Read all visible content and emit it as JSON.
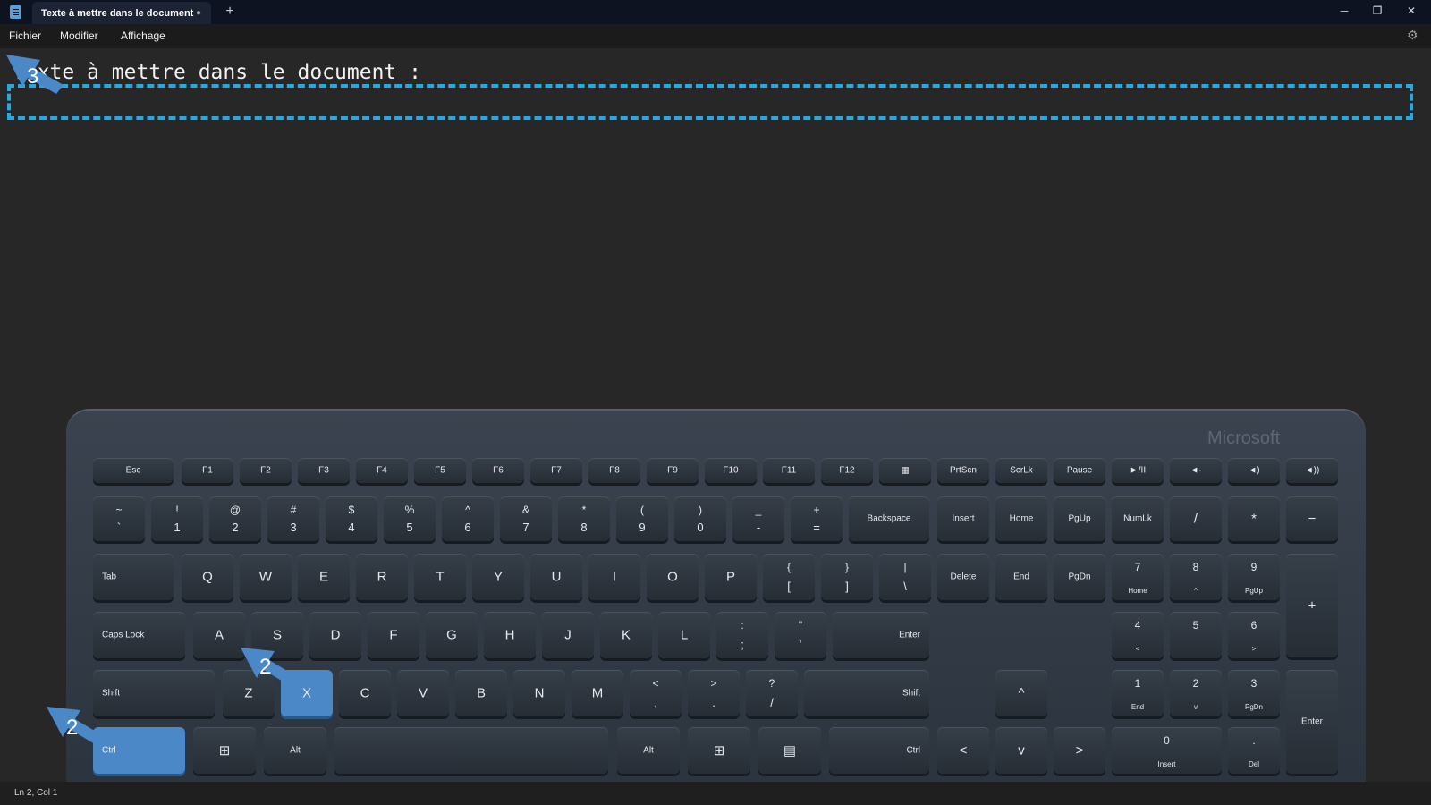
{
  "window": {
    "tab_title": "Texte à mettre dans le document",
    "unsaved_dot": "●",
    "new_tab": "+",
    "minimize": "─",
    "maximize": "❐",
    "close": "✕"
  },
  "menu": {
    "items": [
      "Fichier",
      "Modifier",
      "Affichage"
    ],
    "settings_icon": "gear-icon"
  },
  "editor": {
    "line1": "Texte à mettre dans le document :",
    "highlight_color": "#29a8e0"
  },
  "callouts": {
    "step3": "3",
    "step2_x": "2",
    "step2_ctrl": "2",
    "arrow_color": "#4a88c7"
  },
  "keyboard": {
    "brand": "Microsoft",
    "row_fn": [
      "Esc",
      "F1",
      "F2",
      "F3",
      "F4",
      "F5",
      "F6",
      "F7",
      "F8",
      "F9",
      "F10",
      "F11",
      "F12",
      "",
      "PrtScn",
      "ScrLk",
      "Pause",
      "►/II",
      "◄·",
      "◄)",
      "◄))"
    ],
    "row_num_top": [
      "~",
      "!",
      "@",
      "#",
      "$",
      "%",
      "^",
      "&",
      "*",
      "(",
      ")",
      "_",
      "+"
    ],
    "row_num_bot": [
      "`",
      "1",
      "2",
      "3",
      "4",
      "5",
      "6",
      "7",
      "8",
      "9",
      "0",
      "-",
      "="
    ],
    "backspace": "Backspace",
    "nav1": [
      "Insert",
      "Home",
      "PgUp"
    ],
    "nav2": [
      "Delete",
      "End",
      "PgDn"
    ],
    "numpad_row1": [
      "NumLk",
      "/",
      "*",
      "−"
    ],
    "tab": "Tab",
    "row_q": [
      "Q",
      "W",
      "E",
      "R",
      "T",
      "Y",
      "U",
      "I",
      "O",
      "P"
    ],
    "row_q_pairs_top": [
      "{",
      "}",
      "|"
    ],
    "row_q_pairs_bot": [
      "[",
      "]",
      "\\"
    ],
    "numpad_row2": [
      {
        "main": "7",
        "sub": "Home"
      },
      {
        "main": "8",
        "sub": "^"
      },
      {
        "main": "9",
        "sub": "PgUp"
      }
    ],
    "numpad_plus": "+",
    "caps": "Caps Lock",
    "row_a": [
      "A",
      "S",
      "D",
      "F",
      "G",
      "H",
      "J",
      "K",
      "L"
    ],
    "row_a_pairs_top": [
      ":",
      "\""
    ],
    "row_a_pairs_bot": [
      ";",
      "'"
    ],
    "enter": "Enter",
    "numpad_row3": [
      {
        "main": "4",
        "sub": "<"
      },
      {
        "main": "5",
        "sub": ""
      },
      {
        "main": "6",
        "sub": ">"
      }
    ],
    "shift_left": "Shift",
    "row_z": [
      "Z",
      "X",
      "C",
      "V",
      "B",
      "N",
      "M"
    ],
    "row_z_pairs_top": [
      "<",
      ">",
      "?"
    ],
    "row_z_pairs_bot": [
      ",",
      ".",
      "/"
    ],
    "shift_right": "Shift",
    "arrow_up": "^",
    "numpad_row4": [
      {
        "main": "1",
        "sub": "End"
      },
      {
        "main": "2",
        "sub": "v"
      },
      {
        "main": "3",
        "sub": "PgDn"
      }
    ],
    "numpad_enter": "Enter",
    "ctrl_left": "Ctrl",
    "win_icon": "windows-icon",
    "alt_left": "Alt",
    "alt_right": "Alt",
    "menu_icon": "menu-icon",
    "ctrl_right": "Ctrl",
    "arrows_bottom": [
      "<",
      "v",
      ">"
    ],
    "numpad_row5": [
      {
        "main": "0",
        "sub": "Insert"
      },
      {
        "main": ".",
        "sub": "Del"
      }
    ],
    "highlight_color": "#4a88c7"
  },
  "status": {
    "position": "Ln 2, Col 1"
  }
}
